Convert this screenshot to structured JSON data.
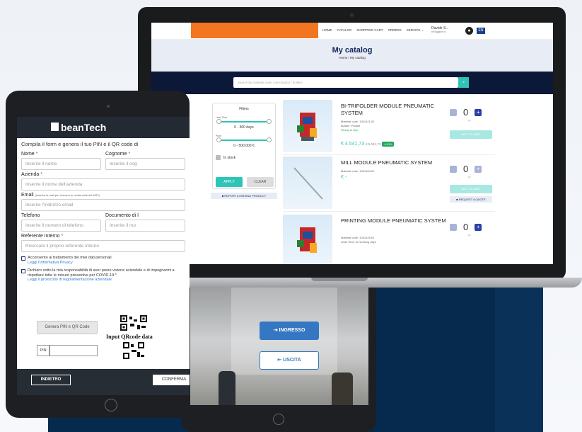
{
  "tablet_form": {
    "brand": "beanTech",
    "intro": "Compila il form e genera il tuo PIN e il QR code di",
    "fields": {
      "nome_label": "Nome",
      "nome_placeholder": "Inserire il nome",
      "cognome_label": "Cognome",
      "cognome_placeholder": "Inserire il cog",
      "azienda_label": "Azienda",
      "azienda_placeholder": "Inserire il nome dell'azienda",
      "email_label": "Email",
      "email_note": "(Inserire la mail per ricevere le credenziali del WIFI)",
      "email_placeholder": "Inserire l'indirizzo email",
      "telefono_label": "Telefono",
      "telefono_placeholder": "Inserire il numero di telefono",
      "documento_label": "Documento di I",
      "documento_placeholder": "Inserire il nur",
      "referente_label": "Referente Interno",
      "referente_placeholder": "Ricercare il proprio referente interno"
    },
    "required_mark": "*",
    "consent1": "Acconsento al trattamento dei miei dati personali.",
    "consent1_link": "Leggi l'informativa Privacy",
    "consent2": "Dichiaro sotto la mia responsabilità di aver preso visione aziendale e di impegnarmi a rispettare tutte le misure preventive per COVID-19 *",
    "consent2_link": "Leggi il protocollo di regolamentazione aziendale",
    "generate_button": "Genera PIN e QR Code",
    "pin_label": "PIN",
    "qr_text": "Input QRcode data",
    "back_button": "INDIETRO",
    "confirm_button": "CONFERMA"
  },
  "tablet_access": {
    "enter_button": "INGRESSO",
    "exit_button": "USCITA"
  },
  "catalog": {
    "nav_links": [
      "HOME",
      "CATALOG",
      "SHOPPING CART",
      "ORDERS",
      "SERVICE ⌄"
    ],
    "user_name": "Davide S...",
    "user_sub": "beTaggiore.it",
    "flag": "EN",
    "title": "My catalog",
    "breadcrumb": "Home / My catalog",
    "search_placeholder": "Search by material code / description / builder",
    "filters": {
      "title": "Filters",
      "lead_time_label": "Lead Time",
      "lead_time_range": "0 - 360 days",
      "price_label": "Price",
      "price_range": "0 - 500.000 €",
      "in_stock_label": "In stock",
      "apply_button": "APPLY",
      "clear_button": "CLEAR"
    },
    "report_button": "REPORT A MISSING PRODUCT",
    "qty_label": "pz",
    "add_to_cart": "ADD TO CART",
    "request_quote": "REQUEST A QUOTE",
    "products": [
      {
        "name": "BI-TRIFOLDER MODULE PNEUMATIC SYSTEM",
        "material_code": "Material code: 1001421.02",
        "builder": "Builder: Panasl",
        "shipping": "Ready to ship",
        "price": "€ 4.541,73",
        "old_price": "€ 5.041,73",
        "discount": "-9.92%",
        "qty": "0"
      },
      {
        "name": "MILL MODULE PNEUMATIC SYSTEM",
        "material_code": "Material code: 1001484.01",
        "price": "€ -",
        "qty": "0"
      },
      {
        "name": "PRINTING MODULE PNEUMATIC SYSTEM",
        "material_code": "Material code: 1001428.01",
        "lead_time": "Lead Time: 52 working days",
        "qty": "0"
      }
    ]
  },
  "colors": {
    "navy": "#0c1838",
    "accent": "#2ec4b6",
    "orange": "#f47521",
    "brand_blue": "#3577c2"
  }
}
